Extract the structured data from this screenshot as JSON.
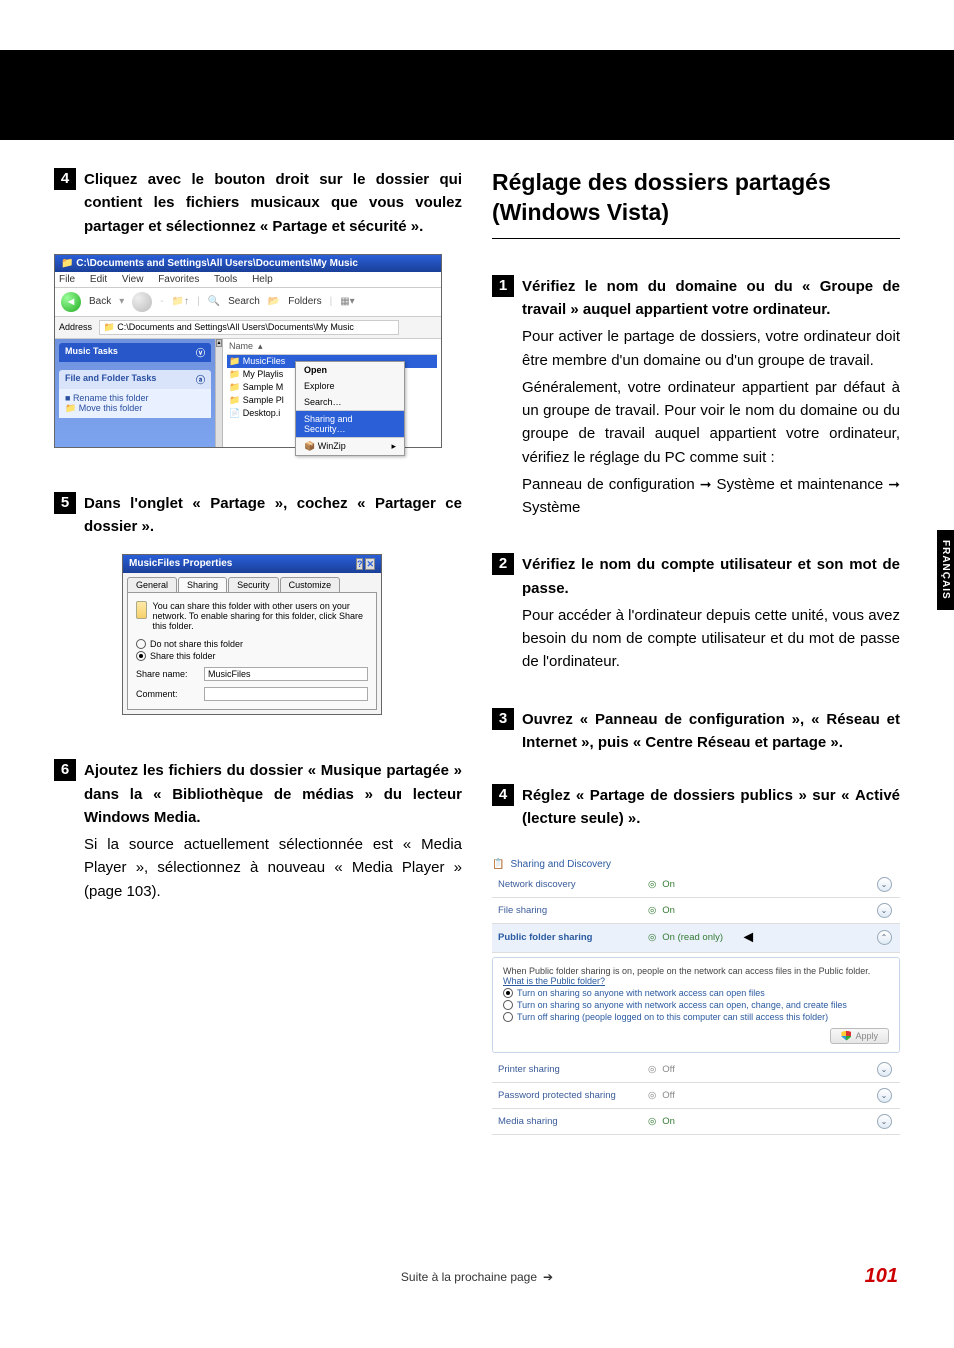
{
  "side_tab": "FRANÇAIS",
  "left": {
    "step4": {
      "num": "4",
      "title": "Cliquez avec le bouton droit sur le dossier qui contient les fichiers musicaux que vous voulez partager et sélectionnez « Partage et sécurité »."
    },
    "step5": {
      "num": "5",
      "title": "Dans l'onglet « Partage », cochez « Partager ce dossier »."
    },
    "step6": {
      "num": "6",
      "title": "Ajoutez les fichiers du dossier « Musique partagée » dans la « Bibliothèque de médias » du lecteur Windows Media.",
      "detail": "Si la source actuellement sélectionnée est « Media Player », sélectionnez à nouveau « Media Player » (page 103)."
    },
    "explorer": {
      "title": "C:\\Documents and Settings\\All Users\\Documents\\My Music",
      "menu": [
        "File",
        "Edit",
        "View",
        "Favorites",
        "Tools",
        "Help"
      ],
      "back": "Back",
      "search": "Search",
      "folders": "Folders",
      "address_label": "Address",
      "address": "C:\\Documents and Settings\\All Users\\Documents\\My Music",
      "side_music_head": "Music Tasks",
      "side_ff_head": "File and Folder Tasks",
      "side_rename": "Rename this folder",
      "side_move": "Move this folder",
      "list_head": "Name",
      "rows": [
        "MusicFiles",
        "My Playlis",
        "Sample M",
        "Sample Pl",
        "Desktop.i"
      ],
      "ctx": {
        "open": "Open",
        "explore": "Explore",
        "search": "Search…",
        "sharing": "Sharing and Security…",
        "winzip": "WinZip"
      }
    },
    "props": {
      "title": "MusicFiles Properties",
      "tabs": [
        "General",
        "Sharing",
        "Security",
        "Customize"
      ],
      "desc": "You can share this folder with other users on your network. To enable sharing for this folder, click Share this folder.",
      "r1": "Do not share this folder",
      "r2": "Share this folder",
      "share_name_lbl": "Share name:",
      "share_name_val": "MusicFiles",
      "comment_lbl": "Comment:"
    }
  },
  "right": {
    "section_title": "Réglage des dossiers partagés (Windows Vista)",
    "step1": {
      "num": "1",
      "title": "Vérifiez le nom du domaine ou du « Groupe de travail » auquel appartient votre ordinateur.",
      "detail1": "Pour activer le partage de dossiers, votre ordinateur doit être membre d'un domaine ou d'un groupe de travail.",
      "detail2": "Généralement, votre ordinateur appartient par défaut à un groupe de travail. Pour voir le nom du domaine ou du groupe de travail auquel appartient votre ordinateur, vérifiez le réglage du PC comme suit :",
      "detail3a": "Panneau de configuration",
      "detail3b": "Système et maintenance",
      "detail3c": "Système"
    },
    "step2": {
      "num": "2",
      "title": "Vérifiez le nom du compte utilisateur et son mot de passe.",
      "detail": "Pour accéder à l'ordinateur depuis cette unité, vous avez besoin du nom de compte utilisateur et du mot de passe de l'ordinateur."
    },
    "step3": {
      "num": "3",
      "title": "Ouvrez « Panneau de configuration », « Réseau et Internet », puis « Centre Réseau et partage »."
    },
    "step4": {
      "num": "4",
      "title": "Réglez « Partage de dossiers publics » sur « Activé (lecture seule) »."
    },
    "vista": {
      "head": "Sharing and Discovery",
      "r_net": {
        "l": "Network discovery",
        "v": "On"
      },
      "r_file": {
        "l": "File sharing",
        "v": "On"
      },
      "r_pub": {
        "l": "Public folder sharing",
        "v": "On (read only)"
      },
      "panel_text": "When Public folder sharing is on, people on the network can access files in the Public folder.",
      "panel_link": "What is the Public folder?",
      "opt1": "Turn on sharing so anyone with network access can open files",
      "opt2": "Turn on sharing so anyone with network access can open, change, and create files",
      "opt3": "Turn off sharing (people logged on to this computer can still access this folder)",
      "apply": "Apply",
      "r_printer": {
        "l": "Printer sharing",
        "v": "Off"
      },
      "r_pwd": {
        "l": "Password protected sharing",
        "v": "Off"
      },
      "r_media": {
        "l": "Media sharing",
        "v": "On"
      }
    }
  },
  "footer": {
    "text": "Suite à la prochaine page",
    "page": "101"
  }
}
